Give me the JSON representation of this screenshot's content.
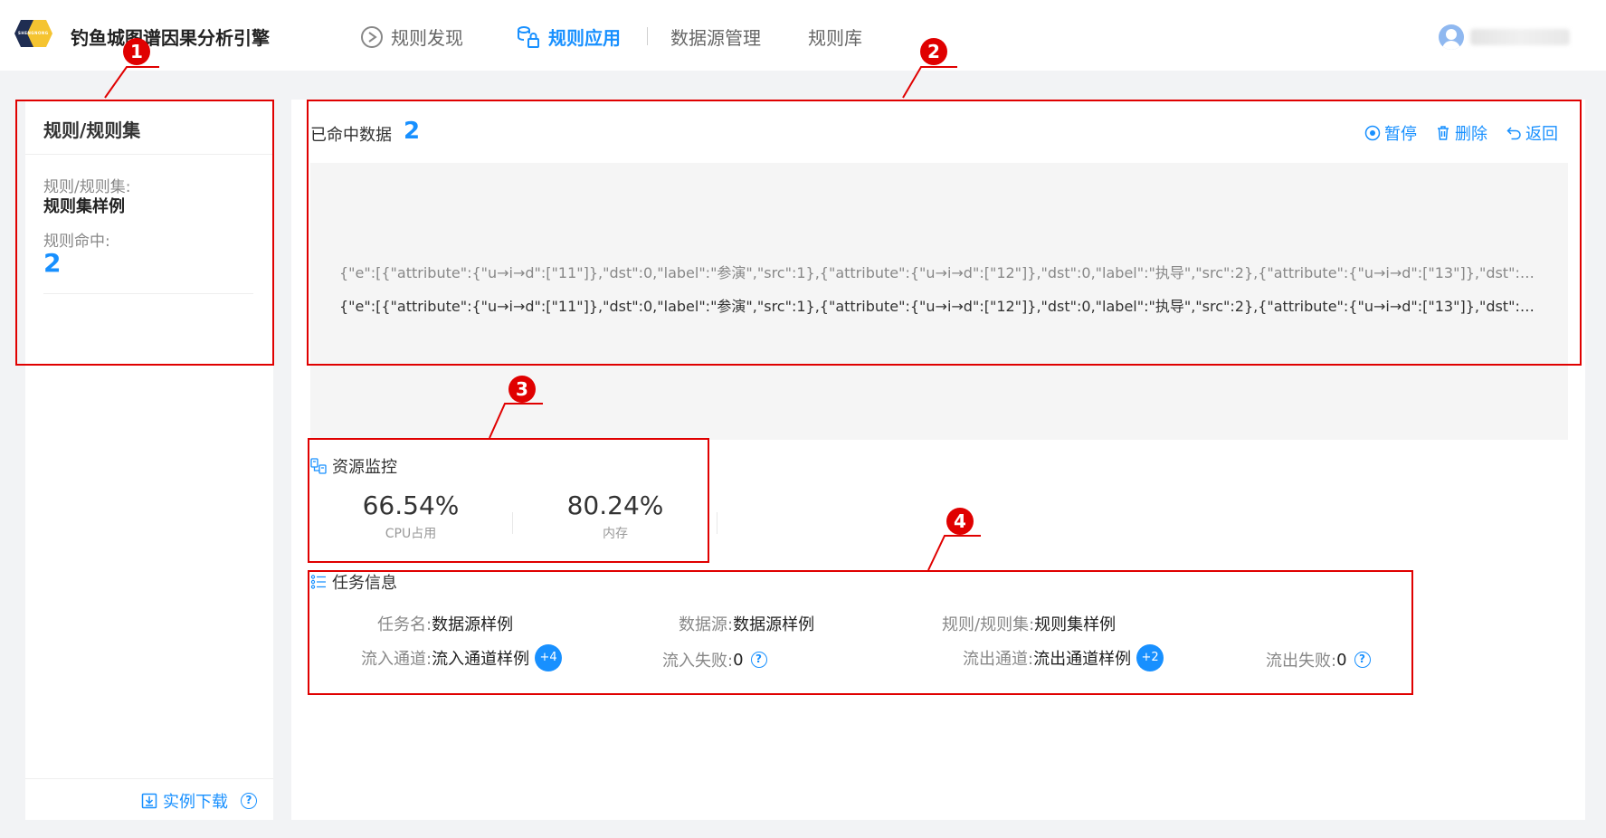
{
  "header": {
    "logo_text": "SHENGNONG",
    "app_title": "钓鱼城图谱因果分析引擎",
    "nav": [
      {
        "label": "规则发现",
        "icon": "play-circle-icon"
      },
      {
        "label": "规则应用",
        "icon": "database-lock-icon",
        "active": true
      },
      {
        "label": "数据源管理"
      },
      {
        "label": "规则库"
      }
    ],
    "user": {
      "icon": "user-avatar-icon"
    }
  },
  "left_panel": {
    "title": "规则/规则集",
    "rule_set_label": "规则/规则集:",
    "rule_set_value": "规则集样例",
    "hit_label": "规则命中:",
    "hit_value": "2",
    "download_label": "实例下载"
  },
  "right_panel": {
    "hit_data_label": "已命中数据",
    "hit_data_count": "2",
    "actions": {
      "pause": "暂停",
      "delete": "删除",
      "back": "返回"
    },
    "data_rows": [
      "{\"e\":[{\"attribute\":{\"u→i→d\":[\"11\"]},\"dst\":0,\"label\":\"参演\",\"src\":1},{\"attribute\":{\"u→i→d\":[\"12\"]},\"dst\":0,\"label\":\"执导\",\"src\":2},{\"attribute\":{\"u→i→d\":[\"13\"]},\"dst\":0,\"label\":\"出品\",\"...",
      "{\"e\":[{\"attribute\":{\"u→i→d\":[\"11\"]},\"dst\":0,\"label\":\"参演\",\"src\":1},{\"attribute\":{\"u→i→d\":[\"12\"]},\"dst\":0,\"label\":\"执导\",\"src\":2},{\"attribute\":{\"u→i→d\":[\"13\"]},\"dst\":0,\"label\":\"出品\",\"..."
    ],
    "resource_monitor": {
      "title": "资源监控",
      "cpu_value": "66.54%",
      "cpu_label": "CPU占用",
      "mem_value": "80.24%",
      "mem_label": "内存"
    },
    "task_info": {
      "title": "任务信息",
      "task_name_key": "任务名:",
      "task_name_val": "数据源样例",
      "source_key": "数据源:",
      "source_val": "数据源样例",
      "ruleset_key": "规则/规则集:",
      "ruleset_val": "规则集样例",
      "in_channel_key": "流入通道:",
      "in_channel_val": "流入通道样例",
      "in_channel_badge": "+4",
      "in_fail_key": "流入失败:",
      "in_fail_val": "0",
      "out_channel_key": "流出通道:",
      "out_channel_val": "流出通道样例",
      "out_channel_badge": "+2",
      "out_fail_key": "流出失败:",
      "out_fail_val": "0"
    }
  },
  "annotations": [
    "1",
    "2",
    "3",
    "4"
  ],
  "colors": {
    "accent": "#1890ff",
    "annotation": "#e00000"
  }
}
